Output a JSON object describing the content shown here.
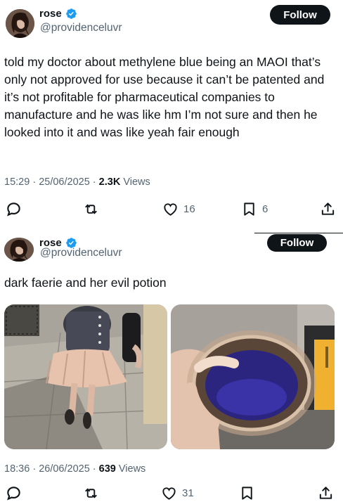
{
  "tweets": [
    {
      "display_name": "rose",
      "handle": "@providenceluvr",
      "follow_label": "Follow",
      "text": "told my doctor about methylene blue being an MAOI that’s only not approved for use because it can’t be patented and it’s not profitable for pharmaceutical companies to manufacture and he was like hm I’m not sure and then he looked into it and was like yeah fair enough",
      "time": "15:29",
      "date": "25/06/2025",
      "views_count": "2.3K",
      "views_label": "Views",
      "likes": "16",
      "bookmarks": "6"
    },
    {
      "display_name": "rose",
      "handle": "@providenceluvr",
      "follow_label": "Follow",
      "text": "dark faerie and her evil potion",
      "time": "18:36",
      "date": "26/06/2025",
      "views_count": "639",
      "views_label": "Views",
      "likes": "31"
    }
  ],
  "colors": {
    "text": "#0f1419",
    "secondary": "#536471",
    "verified": "#1d9bf0",
    "button": "#0f1419"
  },
  "icons": [
    "verified-badge-icon",
    "reply-icon",
    "retweet-icon",
    "like-icon",
    "bookmark-icon",
    "share-icon"
  ]
}
